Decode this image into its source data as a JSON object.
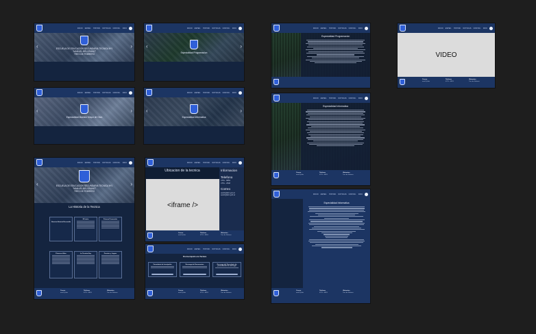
{
  "nav": {
    "links": [
      "INICIO",
      "ESPEC.",
      "HISTOR.",
      "NOTICIAS",
      "CONTAC.",
      "INFO"
    ],
    "links_left": [
      "INICIO",
      "ESPEC.",
      "HISTOR.",
      "NOTICIAS",
      "CONTAC."
    ]
  },
  "frames": {
    "home": {
      "line1": "ESCUELA DE EDUCACION SECUNDARIA TECNICA Nº1",
      "line2": "\"MANUEL BELGRANO\"",
      "line3": "TRES DE FEBRERO"
    },
    "programacion": {
      "caption": "Especialidad Programacion"
    },
    "mmo": {
      "caption": "Especialidad Maestro Mayor de Obra"
    },
    "informatica": {
      "caption": "Especialidad Informatica"
    },
    "history": {
      "title": "La Historia de la Tecnica",
      "cards": [
        "Nuestra Historia Resumida",
        "El Inicio",
        "Primera Promoción",
        "Primeros Años",
        "La Tecnica Hoy",
        "Premios y Logros"
      ]
    },
    "location": {
      "title": "Ubicacion de la tecnica",
      "iframe": "<iframe />",
      "info_heading": "Informacion",
      "phone_label": "Telefono",
      "phone1": "4751 - 6853",
      "phone2": "4751 - 2548",
      "email_label": "Correo",
      "email1": "eest1@abc.gov.ar",
      "email2": "eest1@abc.gob.ar"
    },
    "preinscription": {
      "title": "Pre Inscripción a la Técnica",
      "cards": [
        "Formulario de Inscripción",
        "Descarga de Documentos",
        "Descarga del Formulario de presentación de aval legal"
      ]
    },
    "article_prog": {
      "title": "Especialidad Programacion"
    },
    "article_inf": {
      "title": "Especialidad Informatica"
    },
    "article_inf2": {
      "title": "Especialidad Informatica"
    },
    "video": {
      "label": "VIDEO"
    }
  },
  "footer": {
    "col1_title": "Correo",
    "col1_lines": [
      "eest1@abc",
      "gov.ar"
    ],
    "col2_title": "Telefono",
    "col2_lines": [
      "4751 - 6853",
      "4751 - 2548"
    ],
    "col3_title": "Ubicacion",
    "col3_lines": [
      "Tres de Febrero",
      "Buenos Aires"
    ]
  }
}
